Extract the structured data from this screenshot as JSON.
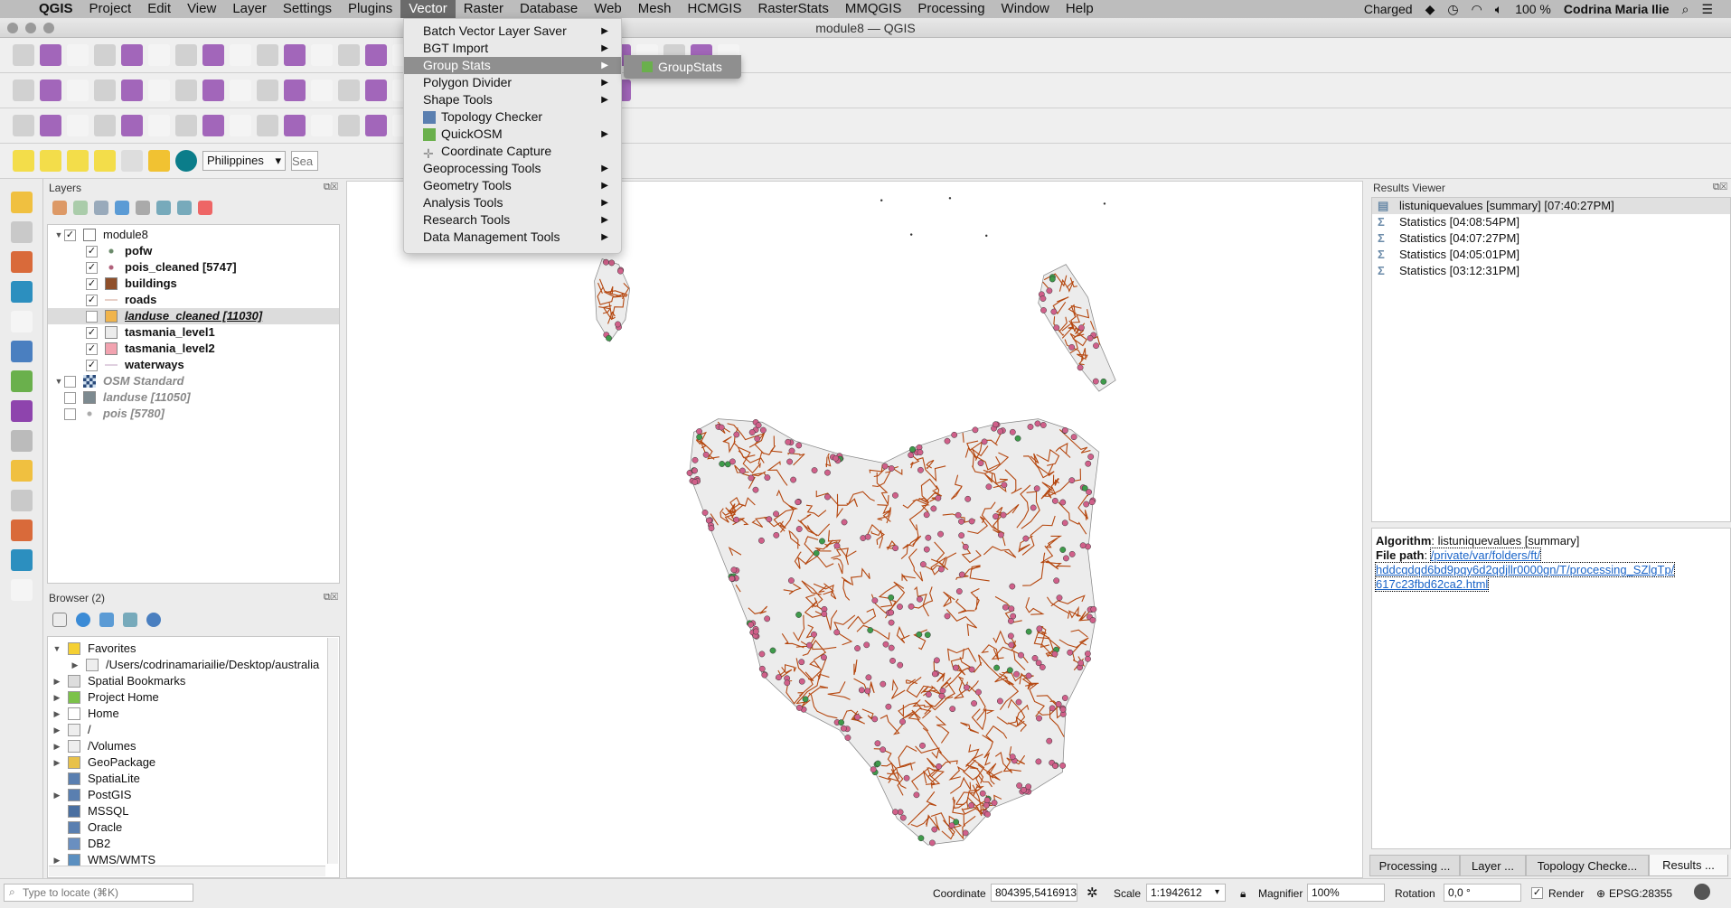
{
  "menubar": {
    "app": "QGIS",
    "items": [
      "Project",
      "Edit",
      "View",
      "Layer",
      "Settings",
      "Plugins",
      "Vector",
      "Raster",
      "Database",
      "Web",
      "Mesh",
      "HCMGIS",
      "RasterStats",
      "MMQGIS",
      "Processing",
      "Window",
      "Help"
    ],
    "active": "Vector",
    "tray": {
      "battery_status": "Charged",
      "battery_pct": "100 %",
      "user": "Codrina Maria Ilie"
    }
  },
  "window": {
    "title": "module8 — QGIS"
  },
  "vector_menu": {
    "items": [
      {
        "label": "Batch Vector Layer Saver",
        "submenu": true
      },
      {
        "label": "BGT Import",
        "submenu": true
      },
      {
        "label": "Group Stats",
        "submenu": true,
        "highlighted": true
      },
      {
        "label": "Polygon Divider",
        "submenu": true
      },
      {
        "label": "Shape Tools",
        "submenu": true
      },
      {
        "label": "Topology Checker",
        "submenu": false,
        "icon": "topology-icon"
      },
      {
        "label": "QuickOSM",
        "submenu": true,
        "icon": "quickosm-icon"
      },
      {
        "label": "Coordinate Capture",
        "submenu": false,
        "icon": "crosshair-icon"
      },
      {
        "label": "Geoprocessing Tools",
        "submenu": true
      },
      {
        "label": "Geometry Tools",
        "submenu": true
      },
      {
        "label": "Analysis Tools",
        "submenu": true
      },
      {
        "label": "Research Tools",
        "submenu": true
      },
      {
        "label": "Data Management Tools",
        "submenu": true
      }
    ],
    "submenu": {
      "label": "GroupStats"
    }
  },
  "toolbar": {
    "locator_country": "Philippines",
    "search_placeholder": "Sea"
  },
  "layers": {
    "title": "Layers",
    "items": [
      {
        "name": "module8",
        "checked": true,
        "group": true,
        "indent": 0,
        "style": "normal",
        "symbol": "group"
      },
      {
        "name": "pofw",
        "checked": true,
        "indent": 1,
        "style": "bold",
        "symbol": "point",
        "color": "#6a8a6a"
      },
      {
        "name": "pois_cleaned [5747]",
        "checked": true,
        "indent": 1,
        "style": "bold",
        "symbol": "point",
        "color": "#b0607a"
      },
      {
        "name": "buildings",
        "checked": true,
        "indent": 1,
        "style": "bold",
        "symbol": "fill",
        "color": "#8f4f2a"
      },
      {
        "name": "roads",
        "checked": true,
        "indent": 1,
        "style": "bold",
        "symbol": "line",
        "color": "#e8d0c8"
      },
      {
        "name": "landuse_cleaned [11030]",
        "checked": false,
        "indent": 1,
        "style": "bolditalicunderline",
        "symbol": "fill",
        "color": "#f0b44c",
        "selected": true
      },
      {
        "name": "tasmania_level1",
        "checked": true,
        "indent": 1,
        "style": "bold",
        "symbol": "fill",
        "color": "#ececec"
      },
      {
        "name": "tasmania_level2",
        "checked": true,
        "indent": 1,
        "style": "bold",
        "symbol": "fill",
        "color": "#f2a3b0"
      },
      {
        "name": "waterways",
        "checked": true,
        "indent": 1,
        "style": "bold",
        "symbol": "line",
        "color": "#e0d0e0"
      },
      {
        "name": "OSM Standard",
        "checked": false,
        "group": true,
        "indent": 0,
        "style": "italicgray",
        "symbol": "tiles"
      },
      {
        "name": "landuse [11050]",
        "checked": false,
        "indent": 0,
        "style": "italicgray",
        "symbol": "fill",
        "color": "#7d8a90"
      },
      {
        "name": "pois [5780]",
        "checked": false,
        "indent": 0,
        "style": "italicgray",
        "symbol": "point",
        "color": "#aaaaaa"
      }
    ]
  },
  "browser": {
    "title": "Browser (2)",
    "items": [
      {
        "label": "Favorites",
        "expanded": true,
        "icon": "star-icon",
        "indent": 0
      },
      {
        "label": "/Users/codrinamariailie/Desktop/australia",
        "icon": "folder-icon",
        "indent": 1,
        "expandable": true
      },
      {
        "label": "Spatial Bookmarks",
        "icon": "bookmark-icon",
        "indent": 0,
        "expandable": true
      },
      {
        "label": "Project Home",
        "icon": "project-home-icon",
        "indent": 0,
        "expandable": true
      },
      {
        "label": "Home",
        "icon": "home-icon",
        "indent": 0,
        "expandable": true
      },
      {
        "label": "/",
        "icon": "folder-icon",
        "indent": 0,
        "expandable": true
      },
      {
        "label": "/Volumes",
        "icon": "folder-icon",
        "indent": 0,
        "expandable": true
      },
      {
        "label": "GeoPackage",
        "icon": "geopackage-icon",
        "indent": 0,
        "expandable": true
      },
      {
        "label": "SpatiaLite",
        "icon": "spatialite-icon",
        "indent": 0
      },
      {
        "label": "PostGIS",
        "icon": "postgis-icon",
        "indent": 0,
        "expandable": true
      },
      {
        "label": "MSSQL",
        "icon": "mssql-icon",
        "indent": 0
      },
      {
        "label": "Oracle",
        "icon": "oracle-icon",
        "indent": 0
      },
      {
        "label": "DB2",
        "icon": "db2-icon",
        "indent": 0
      },
      {
        "label": "WMS/WMTS",
        "icon": "globe-icon",
        "indent": 0,
        "expandable": true
      }
    ]
  },
  "results": {
    "title": "Results Viewer",
    "items": [
      {
        "label": "listuniquevalues [summary] [07:40:27PM]",
        "icon": "table-icon",
        "selected": true
      },
      {
        "label": "Statistics [04:08:54PM]",
        "icon": "sigma-icon"
      },
      {
        "label": "Statistics [04:07:27PM]",
        "icon": "sigma-icon"
      },
      {
        "label": "Statistics [04:05:01PM]",
        "icon": "sigma-icon"
      },
      {
        "label": "Statistics [03:12:31PM]",
        "icon": "sigma-icon"
      }
    ],
    "algorithm_label": "Algorithm",
    "algorithm": "listuniquevalues [summary]",
    "filepath_label": "File path",
    "filepath": [
      "/private/var/folders/ft/",
      "hddcqdqd6bd9pqy6d2qdjllr0000gn/T/processing_SZlgTp/",
      "617c23fbd62ca2.html"
    ]
  },
  "dock_tabs": [
    "Processing ...",
    "Layer ...",
    "Topology Checke...",
    "Results ..."
  ],
  "status": {
    "locate_placeholder": "Type to locate (⌘K)",
    "coordinate_label": "Coordinate",
    "coordinate": "804395,5416913",
    "scale_label": "Scale",
    "scale": "1:1942612",
    "magnifier_label": "Magnifier",
    "magnifier": "100%",
    "rotation_label": "Rotation",
    "rotation": "0,0 °",
    "render_label": "Render",
    "render": true,
    "crs": "EPSG:28355"
  },
  "colors": {
    "roads": "#b5470f",
    "pois": "#d0608a",
    "pofw": "#3e9a4a",
    "land": "#ececec"
  }
}
